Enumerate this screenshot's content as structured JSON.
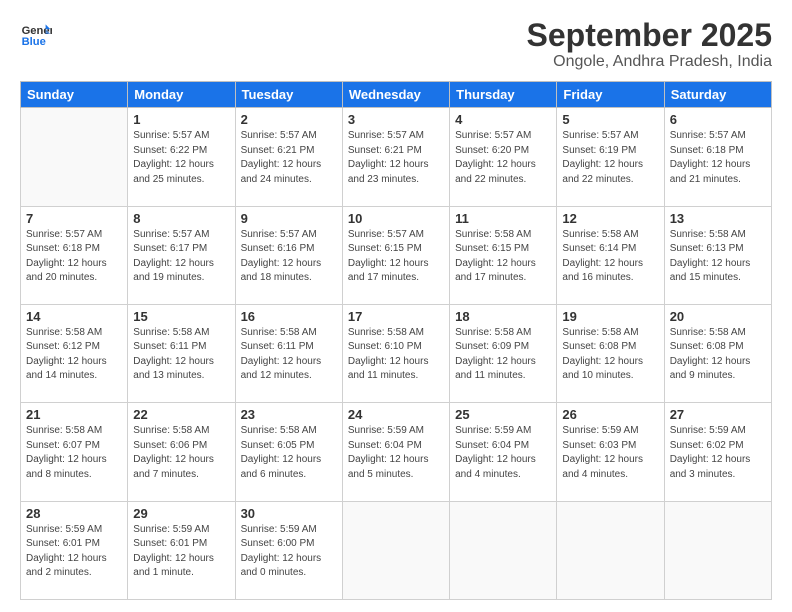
{
  "header": {
    "logo_line1": "General",
    "logo_line2": "Blue",
    "title": "September 2025",
    "subtitle": "Ongole, Andhra Pradesh, India"
  },
  "days_of_week": [
    "Sunday",
    "Monday",
    "Tuesday",
    "Wednesday",
    "Thursday",
    "Friday",
    "Saturday"
  ],
  "weeks": [
    [
      {
        "day": "",
        "info": ""
      },
      {
        "day": "1",
        "info": "Sunrise: 5:57 AM\nSunset: 6:22 PM\nDaylight: 12 hours\nand 25 minutes."
      },
      {
        "day": "2",
        "info": "Sunrise: 5:57 AM\nSunset: 6:21 PM\nDaylight: 12 hours\nand 24 minutes."
      },
      {
        "day": "3",
        "info": "Sunrise: 5:57 AM\nSunset: 6:21 PM\nDaylight: 12 hours\nand 23 minutes."
      },
      {
        "day": "4",
        "info": "Sunrise: 5:57 AM\nSunset: 6:20 PM\nDaylight: 12 hours\nand 22 minutes."
      },
      {
        "day": "5",
        "info": "Sunrise: 5:57 AM\nSunset: 6:19 PM\nDaylight: 12 hours\nand 22 minutes."
      },
      {
        "day": "6",
        "info": "Sunrise: 5:57 AM\nSunset: 6:18 PM\nDaylight: 12 hours\nand 21 minutes."
      }
    ],
    [
      {
        "day": "7",
        "info": "Sunrise: 5:57 AM\nSunset: 6:18 PM\nDaylight: 12 hours\nand 20 minutes."
      },
      {
        "day": "8",
        "info": "Sunrise: 5:57 AM\nSunset: 6:17 PM\nDaylight: 12 hours\nand 19 minutes."
      },
      {
        "day": "9",
        "info": "Sunrise: 5:57 AM\nSunset: 6:16 PM\nDaylight: 12 hours\nand 18 minutes."
      },
      {
        "day": "10",
        "info": "Sunrise: 5:57 AM\nSunset: 6:15 PM\nDaylight: 12 hours\nand 17 minutes."
      },
      {
        "day": "11",
        "info": "Sunrise: 5:58 AM\nSunset: 6:15 PM\nDaylight: 12 hours\nand 17 minutes."
      },
      {
        "day": "12",
        "info": "Sunrise: 5:58 AM\nSunset: 6:14 PM\nDaylight: 12 hours\nand 16 minutes."
      },
      {
        "day": "13",
        "info": "Sunrise: 5:58 AM\nSunset: 6:13 PM\nDaylight: 12 hours\nand 15 minutes."
      }
    ],
    [
      {
        "day": "14",
        "info": "Sunrise: 5:58 AM\nSunset: 6:12 PM\nDaylight: 12 hours\nand 14 minutes."
      },
      {
        "day": "15",
        "info": "Sunrise: 5:58 AM\nSunset: 6:11 PM\nDaylight: 12 hours\nand 13 minutes."
      },
      {
        "day": "16",
        "info": "Sunrise: 5:58 AM\nSunset: 6:11 PM\nDaylight: 12 hours\nand 12 minutes."
      },
      {
        "day": "17",
        "info": "Sunrise: 5:58 AM\nSunset: 6:10 PM\nDaylight: 12 hours\nand 11 minutes."
      },
      {
        "day": "18",
        "info": "Sunrise: 5:58 AM\nSunset: 6:09 PM\nDaylight: 12 hours\nand 11 minutes."
      },
      {
        "day": "19",
        "info": "Sunrise: 5:58 AM\nSunset: 6:08 PM\nDaylight: 12 hours\nand 10 minutes."
      },
      {
        "day": "20",
        "info": "Sunrise: 5:58 AM\nSunset: 6:08 PM\nDaylight: 12 hours\nand 9 minutes."
      }
    ],
    [
      {
        "day": "21",
        "info": "Sunrise: 5:58 AM\nSunset: 6:07 PM\nDaylight: 12 hours\nand 8 minutes."
      },
      {
        "day": "22",
        "info": "Sunrise: 5:58 AM\nSunset: 6:06 PM\nDaylight: 12 hours\nand 7 minutes."
      },
      {
        "day": "23",
        "info": "Sunrise: 5:58 AM\nSunset: 6:05 PM\nDaylight: 12 hours\nand 6 minutes."
      },
      {
        "day": "24",
        "info": "Sunrise: 5:59 AM\nSunset: 6:04 PM\nDaylight: 12 hours\nand 5 minutes."
      },
      {
        "day": "25",
        "info": "Sunrise: 5:59 AM\nSunset: 6:04 PM\nDaylight: 12 hours\nand 4 minutes."
      },
      {
        "day": "26",
        "info": "Sunrise: 5:59 AM\nSunset: 6:03 PM\nDaylight: 12 hours\nand 4 minutes."
      },
      {
        "day": "27",
        "info": "Sunrise: 5:59 AM\nSunset: 6:02 PM\nDaylight: 12 hours\nand 3 minutes."
      }
    ],
    [
      {
        "day": "28",
        "info": "Sunrise: 5:59 AM\nSunset: 6:01 PM\nDaylight: 12 hours\nand 2 minutes."
      },
      {
        "day": "29",
        "info": "Sunrise: 5:59 AM\nSunset: 6:01 PM\nDaylight: 12 hours\nand 1 minute."
      },
      {
        "day": "30",
        "info": "Sunrise: 5:59 AM\nSunset: 6:00 PM\nDaylight: 12 hours\nand 0 minutes."
      },
      {
        "day": "",
        "info": ""
      },
      {
        "day": "",
        "info": ""
      },
      {
        "day": "",
        "info": ""
      },
      {
        "day": "",
        "info": ""
      }
    ]
  ]
}
